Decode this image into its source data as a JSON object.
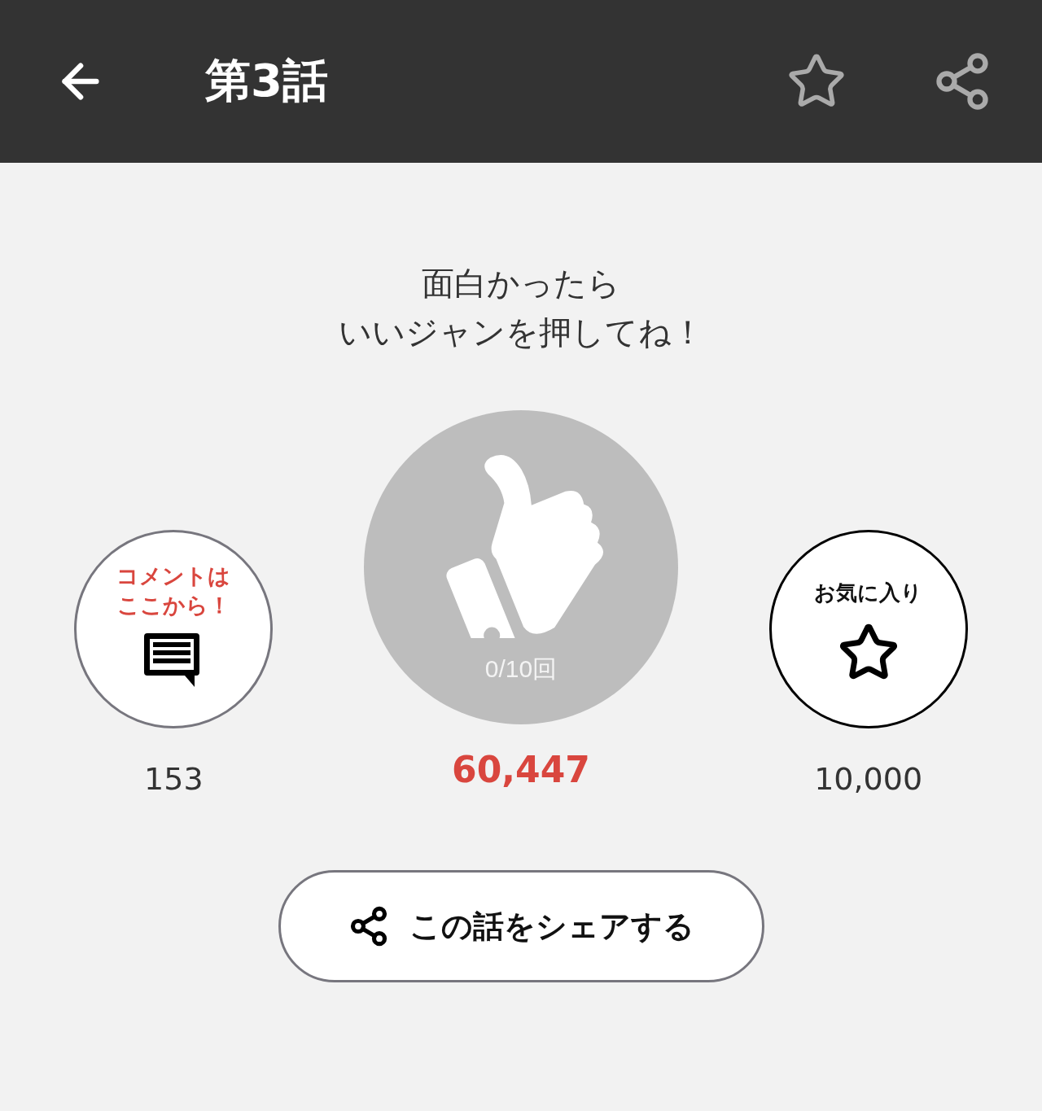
{
  "header": {
    "title": "第3話"
  },
  "prompt": [
    "面白かったら",
    "いいジャンを押してね！"
  ],
  "comment": {
    "label_lines": [
      "コメントは",
      "ここから！"
    ],
    "count": "153"
  },
  "like": {
    "tally": "0/10回",
    "count": "60,447",
    "selected": false
  },
  "favorite": {
    "label": "お気に入り",
    "count": "10,000",
    "selected": false
  },
  "share_button": {
    "label": "この話をシェアする"
  }
}
